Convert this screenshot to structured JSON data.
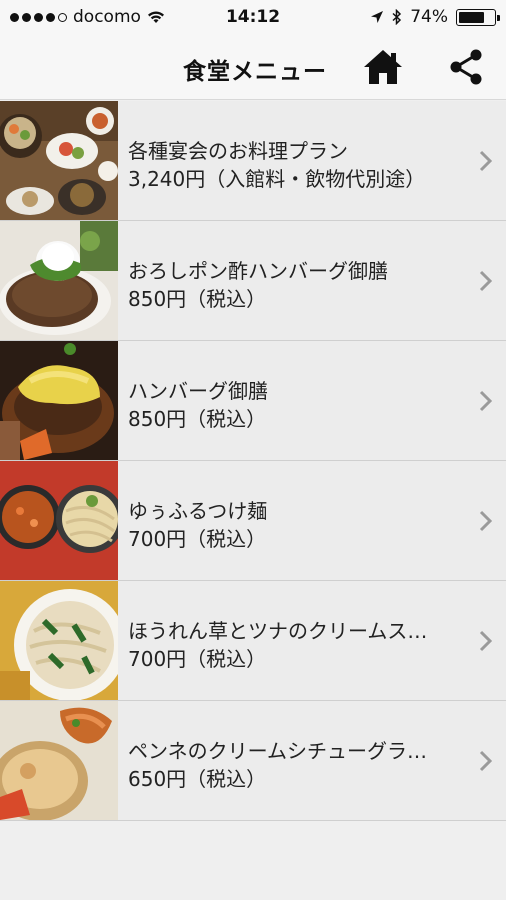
{
  "status_bar": {
    "carrier": "docomo",
    "time": "14:12",
    "battery_percent": "74%",
    "battery_level": 0.74
  },
  "nav": {
    "title": "食堂メニュー",
    "home_icon": "home-icon",
    "share_icon": "share-icon"
  },
  "menu_items": [
    {
      "name": "各種宴会のお料理プラン",
      "price": "3,240円（入館料・飲物代別途）",
      "thumb": "banquet-photo"
    },
    {
      "name": "おろしポン酢ハンバーグ御膳",
      "price": "850円（税込）",
      "thumb": "oroshi-hamburg-photo"
    },
    {
      "name": "ハンバーグ御膳",
      "price": "850円（税込）",
      "thumb": "hamburg-photo"
    },
    {
      "name": "ゆぅふるつけ麺",
      "price": "700円（税込）",
      "thumb": "tsukemen-photo"
    },
    {
      "name": "ほうれん草とツナのクリームス…",
      "price": "700円（税込）",
      "thumb": "cream-pasta-photo"
    },
    {
      "name": "ペンネのクリームシチューグラ…",
      "price": "650円（税込）",
      "thumb": "penne-gratin-photo"
    }
  ],
  "colors": {
    "background": "#efefef",
    "row_background": "#ececec",
    "bar_background": "#f7f7f7",
    "chevron": "#9a9a9a"
  }
}
